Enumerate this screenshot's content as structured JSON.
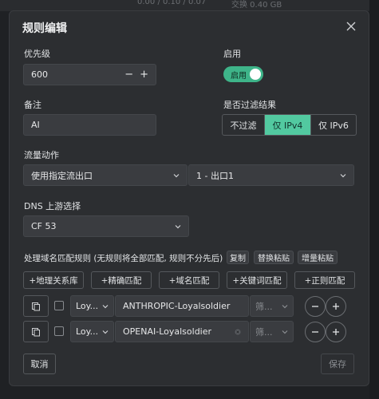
{
  "background": {
    "top_left_text": "0.00 / 0.10 / 0.07",
    "top_right_text": "交换 0.40 GB"
  },
  "dialog": {
    "title": "规则编辑",
    "priority": {
      "label": "优先级",
      "value": "600",
      "minus": "−",
      "plus": "+"
    },
    "enabled": {
      "label": "启用",
      "toggle_text": "启用",
      "on": true
    },
    "remark": {
      "label": "备注",
      "value": "AI"
    },
    "filter": {
      "label": "是否过滤结果",
      "options": [
        "不过滤",
        "仅 IPv4",
        "仅 IPv6"
      ],
      "selected": "仅 IPv4"
    },
    "flow": {
      "label": "流量动作",
      "action": "使用指定流出口",
      "exit": "1 - 出口1"
    },
    "dns": {
      "label": "DNS 上游选择",
      "value": "CF 53"
    },
    "domain_rules": {
      "label": "处理域名匹配规则 (无规则将全部匹配, 规则不分先后)",
      "copy": "复制",
      "replace_paste": "替换粘贴",
      "append_paste": "增量粘贴",
      "add_buttons": [
        "+地理关系库",
        "+精确匹配",
        "+域名匹配",
        "+关键词匹配",
        "+正则匹配"
      ],
      "rows": [
        {
          "source": "Loy...",
          "value": "ANTHROPIC-Loyalsoldier",
          "filter_placeholder": "筛..."
        },
        {
          "source": "Loy...",
          "value": "OPENAI-Loyalsoldier",
          "filter_placeholder": "筛..."
        }
      ]
    },
    "footer": {
      "cancel": "取消",
      "save": "保存"
    }
  },
  "colors": {
    "accent": "#52c9a0",
    "toggle": "#3eb489",
    "dialog_bg": "#2c2e31"
  },
  "icons": [
    "close-icon",
    "chevron-down-icon",
    "clear-icon",
    "copy-rule-icon",
    "minus-icon",
    "plus-icon"
  ]
}
